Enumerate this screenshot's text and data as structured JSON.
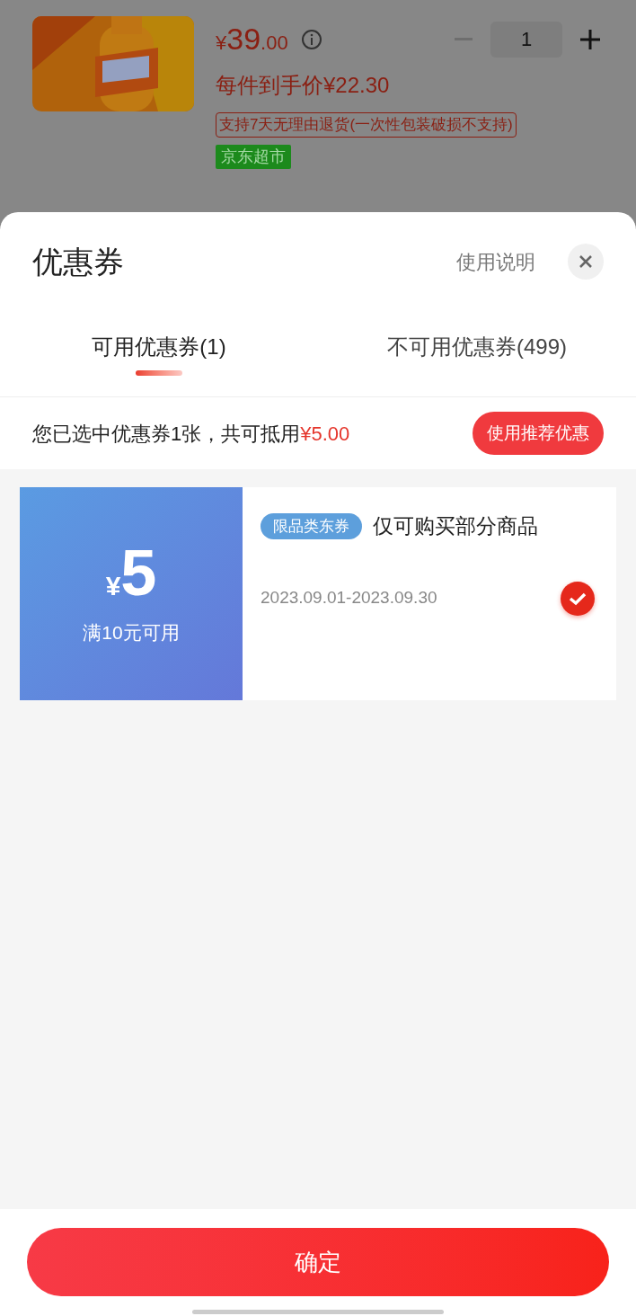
{
  "product": {
    "kind": "picture",
    "price_currency": "¥",
    "price_integer": "39",
    "price_decimal": ".00",
    "final_price": "每件到手价¥22.30",
    "quantity": "1",
    "return_policy": "支持7天无理由退货(一次性包装破损不支持)",
    "store_tag": "京东超市"
  },
  "sheet": {
    "title": "优惠券",
    "help_link": "使用说明",
    "tabs": [
      {
        "label": "可用优惠券(1)",
        "selected": true
      },
      {
        "label": "不可用优惠券(499)",
        "selected": false
      }
    ],
    "summary": {
      "text": "您已选中优惠券1张，共可抵用",
      "amount": "¥5.00",
      "button": "使用推荐优惠"
    },
    "coupons": [
      {
        "currency": "¥",
        "amount": "5",
        "condition": "满10元可用",
        "tag": "限品类东券",
        "description": "仅可购买部分商品",
        "validity": "2023.09.01-2023.09.30",
        "selected": true
      }
    ],
    "confirm_button": "确定"
  }
}
